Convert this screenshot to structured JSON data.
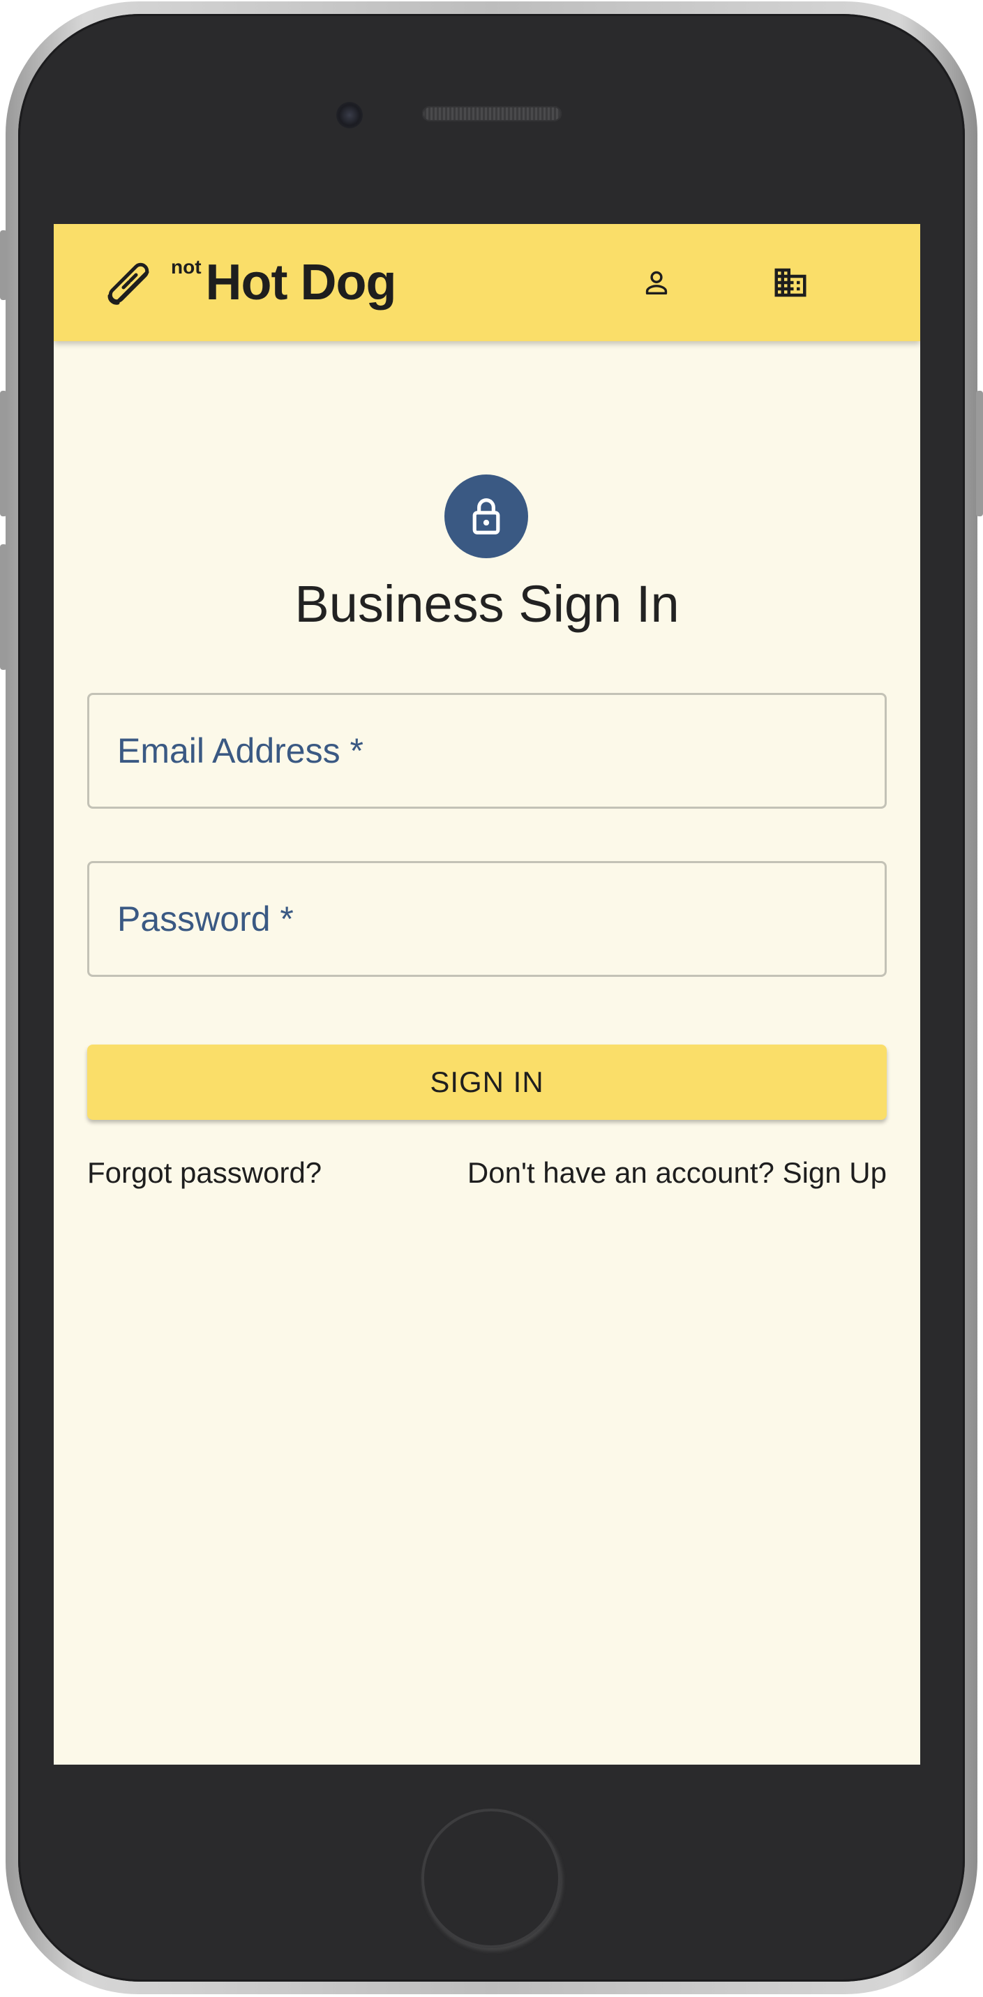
{
  "app": {
    "brand_prefix": "not",
    "brand_name": "Hot Dog",
    "brand_icon": "hot-dog-icon",
    "accent_color": "#fade69",
    "primary_color": "#3a5983",
    "background_color": "#fcf9e9"
  },
  "appbar": {
    "icons": [
      "person-icon",
      "business-building-icon"
    ]
  },
  "form": {
    "avatar_icon": "lock-icon",
    "title": "Business Sign In",
    "email_placeholder": "Email Address *",
    "email_value": "",
    "password_placeholder": "Password *",
    "password_value": "",
    "submit_label": "SIGN IN",
    "forgot_label": "Forgot password?",
    "signup_label": "Don't have an account? Sign Up"
  }
}
